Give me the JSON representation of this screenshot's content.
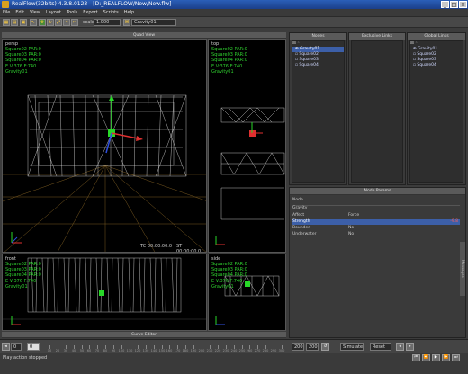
{
  "window": {
    "title": "RealFlow(32bits) 4.3.8.0123 - [D:_REALFLOW/New/New.flw]"
  },
  "menu": [
    "File",
    "Edit",
    "View",
    "Layout",
    "Tools",
    "Export",
    "Scripts",
    "Help"
  ],
  "toolbar": {
    "scale_label": "scale",
    "scale_value": "1.000",
    "active_object": "Gravity01"
  },
  "quad_view_title": "Quad View",
  "viewports": {
    "persp": {
      "label": "persp",
      "stats": [
        "Square02 PAR:0",
        "Square03 PAR:0",
        "Square04 PAR:0",
        "E V:376 F:740",
        "Gravity01"
      ],
      "tc": "TC 00:00:00.0",
      "st": "ST 00:00:00.0"
    },
    "top": {
      "label": "top",
      "stats": [
        "Square02 PAR:0",
        "Square03 PAR:0",
        "Square04 PAR:0",
        "E V:376 F:740",
        "Gravity01"
      ]
    },
    "front": {
      "label": "front",
      "stats": [
        "Square02 PAR:0",
        "Square03 PAR:0",
        "Square04 PAR:0",
        "E V:376 F:740",
        "Gravity01"
      ]
    },
    "side": {
      "label": "side",
      "stats": [
        "Square02 PAR:0",
        "Square03 PAR:0",
        "Square04 PAR:0",
        "E V:376 F:740",
        "Gravity01"
      ]
    }
  },
  "curve_editor_title": "Curve Editor",
  "nodes_panel": {
    "title": "Nodes",
    "items": [
      "Gravity01",
      "Square02",
      "Square03",
      "Square04"
    ],
    "selected": "Gravity01"
  },
  "exclusive_links_panel": {
    "title": "Exclusive Links"
  },
  "global_links_panel": {
    "title": "Global Links",
    "items": [
      "Gravity01",
      "Square02",
      "Square03",
      "Square04"
    ]
  },
  "node_params": {
    "title": "Node Params",
    "rows": [
      {
        "label": "Node",
        "value": ""
      },
      {
        "label": "Gravity",
        "value": ""
      },
      {
        "label": "Affect",
        "value": "Force"
      },
      {
        "label": "Strength",
        "value": "",
        "extra": "-9.8",
        "highlight": true
      },
      {
        "label": "Bounded",
        "value": "No"
      },
      {
        "label": "Underwater",
        "value": "No"
      }
    ],
    "side_tab": "Messages"
  },
  "timeline": {
    "start": "0",
    "current": "0",
    "ticks": [
      "10",
      "20",
      "30",
      "40",
      "50",
      "60",
      "70",
      "80",
      "90",
      "100",
      "110",
      "120",
      "130",
      "140",
      "150",
      "160",
      "170",
      "180",
      "190",
      "200",
      "210",
      "220",
      "230",
      "240",
      "250",
      "260",
      "270",
      "280",
      "290",
      "300"
    ],
    "end_frame": "200",
    "end_frame_b": "200",
    "simulate_label": "Simulate",
    "reset_label": "Reset"
  },
  "status": {
    "message": "Play action stopped"
  }
}
